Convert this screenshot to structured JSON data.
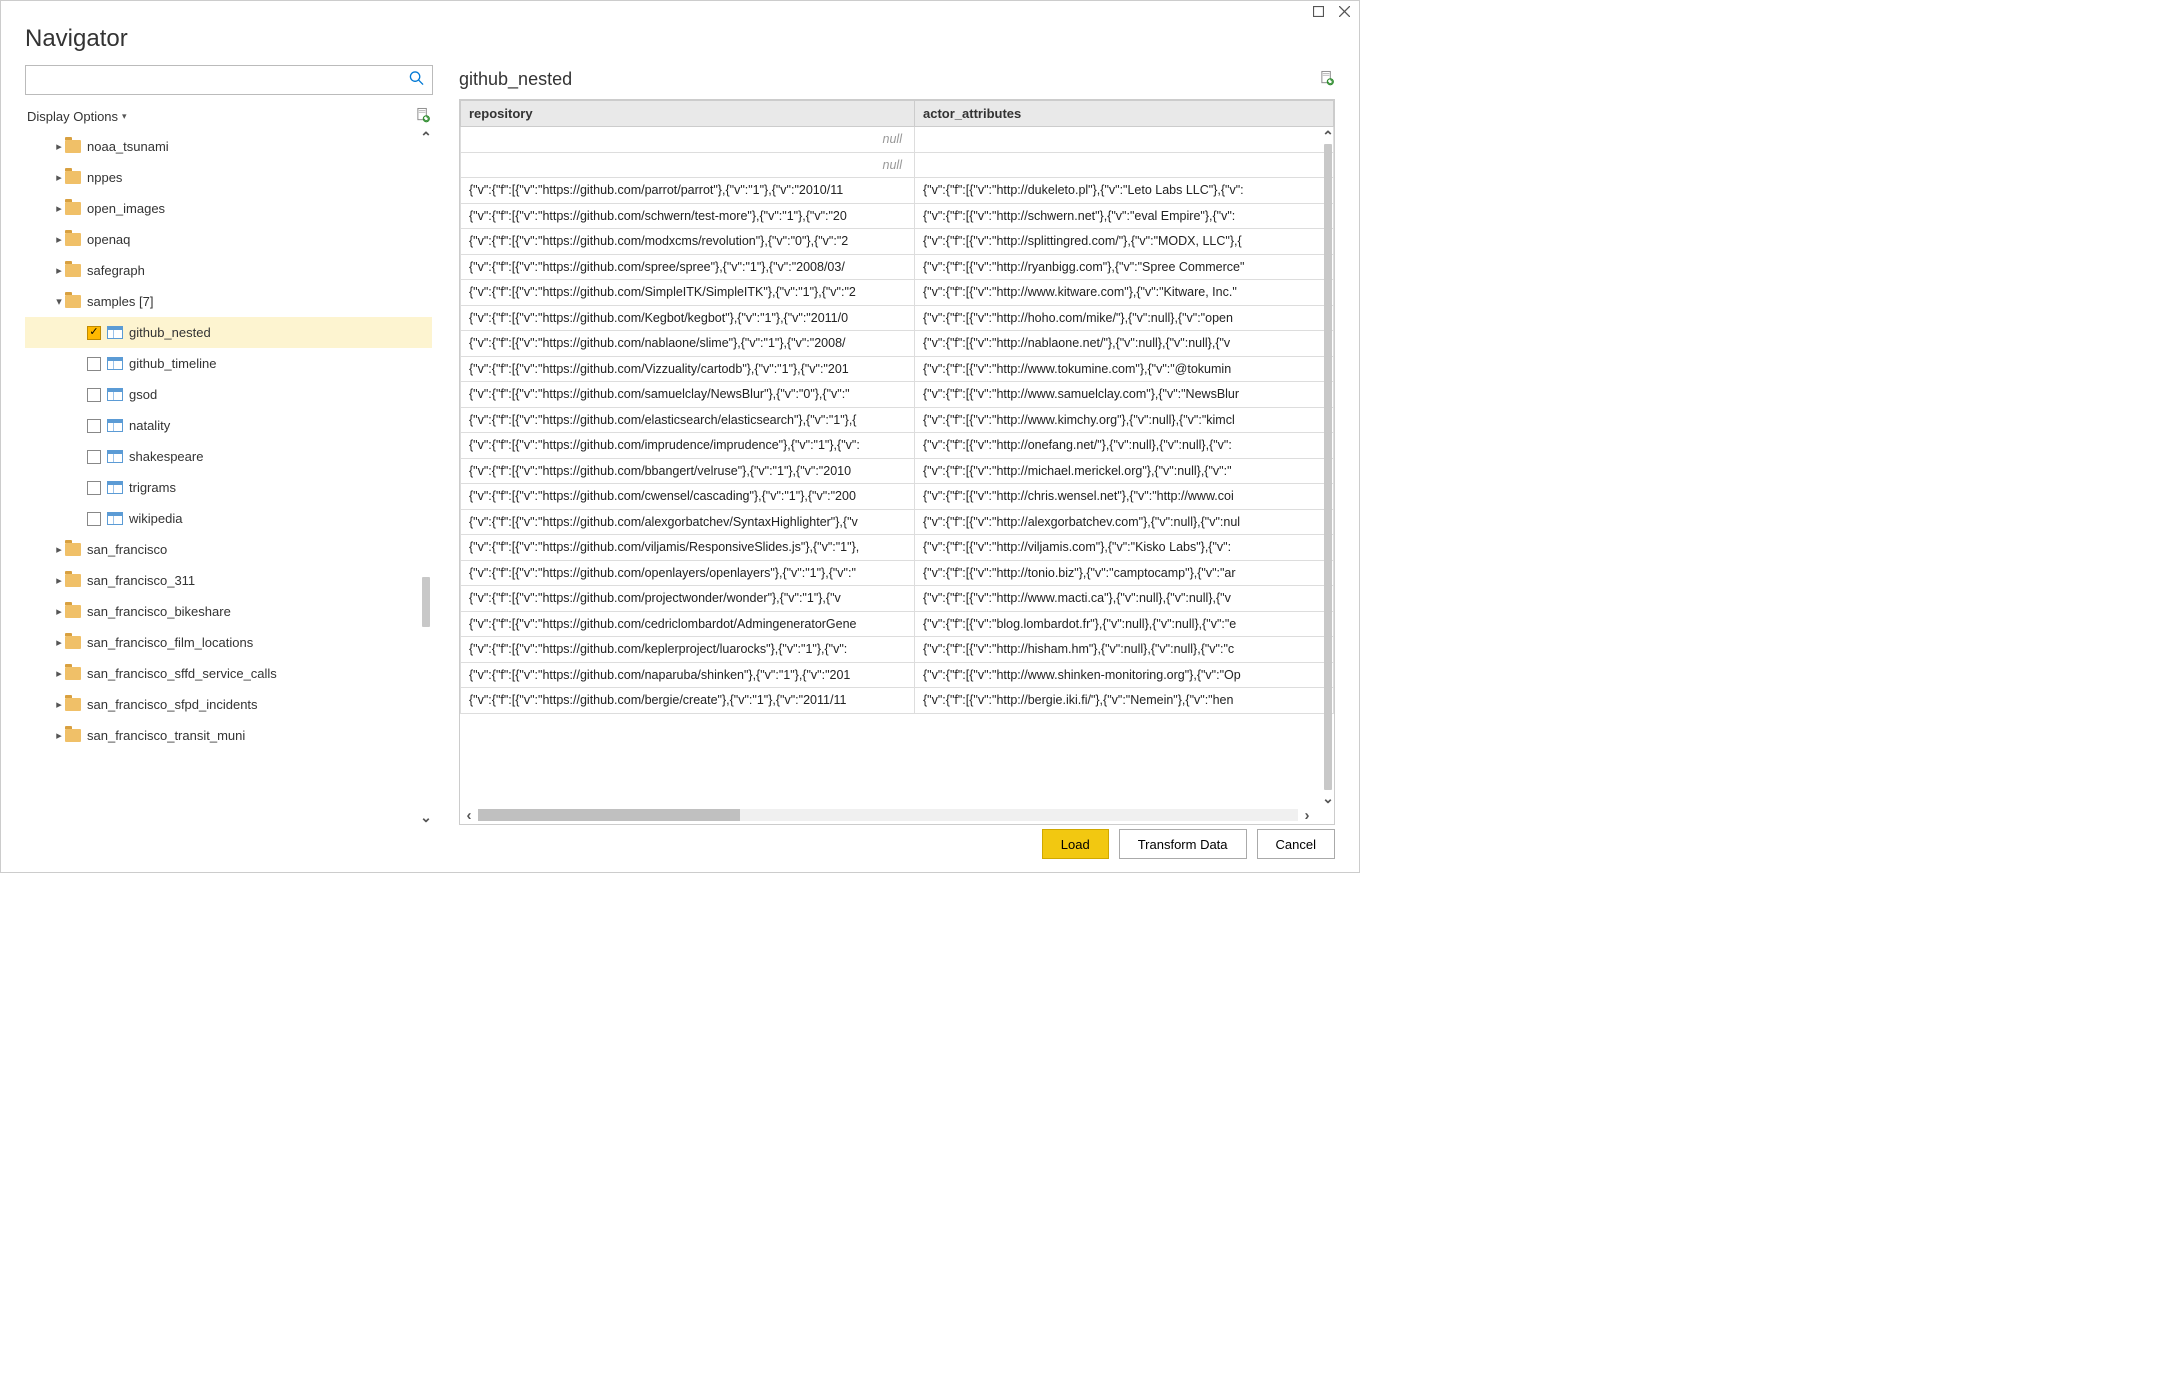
{
  "window": {
    "title": "Navigator"
  },
  "search": {
    "placeholder": ""
  },
  "options": {
    "label": "Display Options"
  },
  "tree": {
    "items": [
      {
        "indent": 1,
        "arrow": "closed",
        "icon": "folder",
        "label": "noaa_tsunami",
        "interactable_row": true
      },
      {
        "indent": 1,
        "arrow": "closed",
        "icon": "folder",
        "label": "nppes"
      },
      {
        "indent": 1,
        "arrow": "closed",
        "icon": "folder",
        "label": "open_images"
      },
      {
        "indent": 1,
        "arrow": "closed",
        "icon": "folder",
        "label": "openaq"
      },
      {
        "indent": 1,
        "arrow": "closed",
        "icon": "folder",
        "label": "safegraph"
      },
      {
        "indent": 1,
        "arrow": "open",
        "icon": "folder",
        "label": "samples [7]"
      },
      {
        "indent": 2,
        "arrow": "none",
        "icon": "table",
        "label": "github_nested",
        "checked": true,
        "selected": true,
        "checkbox": true
      },
      {
        "indent": 2,
        "arrow": "none",
        "icon": "table",
        "label": "github_timeline",
        "checkbox": true
      },
      {
        "indent": 2,
        "arrow": "none",
        "icon": "table",
        "label": "gsod",
        "checkbox": true
      },
      {
        "indent": 2,
        "arrow": "none",
        "icon": "table",
        "label": "natality",
        "checkbox": true
      },
      {
        "indent": 2,
        "arrow": "none",
        "icon": "table",
        "label": "shakespeare",
        "checkbox": true
      },
      {
        "indent": 2,
        "arrow": "none",
        "icon": "table",
        "label": "trigrams",
        "checkbox": true
      },
      {
        "indent": 2,
        "arrow": "none",
        "icon": "table",
        "label": "wikipedia",
        "checkbox": true
      },
      {
        "indent": 1,
        "arrow": "closed",
        "icon": "folder",
        "label": "san_francisco"
      },
      {
        "indent": 1,
        "arrow": "closed",
        "icon": "folder",
        "label": "san_francisco_311"
      },
      {
        "indent": 1,
        "arrow": "closed",
        "icon": "folder",
        "label": "san_francisco_bikeshare"
      },
      {
        "indent": 1,
        "arrow": "closed",
        "icon": "folder",
        "label": "san_francisco_film_locations"
      },
      {
        "indent": 1,
        "arrow": "closed",
        "icon": "folder",
        "label": "san_francisco_sffd_service_calls"
      },
      {
        "indent": 1,
        "arrow": "closed",
        "icon": "folder",
        "label": "san_francisco_sfpd_incidents"
      },
      {
        "indent": 1,
        "arrow": "closed",
        "icon": "folder",
        "label": "san_francisco_transit_muni"
      }
    ]
  },
  "preview": {
    "title": "github_nested",
    "columns": [
      "repository",
      "actor_attributes"
    ],
    "rows": [
      {
        "repository_null": true,
        "actor_null": true
      },
      {
        "repository_null": true,
        "actor_null": true
      },
      {
        "repository": "{\"v\":{\"f\":[{\"v\":\"https://github.com/parrot/parrot\"},{\"v\":\"1\"},{\"v\":\"2010/11",
        "actor": "{\"v\":{\"f\":[{\"v\":\"http://dukeleto.pl\"},{\"v\":\"Leto Labs LLC\"},{\"v\":"
      },
      {
        "repository": "{\"v\":{\"f\":[{\"v\":\"https://github.com/schwern/test-more\"},{\"v\":\"1\"},{\"v\":\"20",
        "actor": "{\"v\":{\"f\":[{\"v\":\"http://schwern.net\"},{\"v\":\"eval Empire\"},{\"v\":"
      },
      {
        "repository": "{\"v\":{\"f\":[{\"v\":\"https://github.com/modxcms/revolution\"},{\"v\":\"0\"},{\"v\":\"2",
        "actor": "{\"v\":{\"f\":[{\"v\":\"http://splittingred.com/\"},{\"v\":\"MODX, LLC\"},{"
      },
      {
        "repository": "{\"v\":{\"f\":[{\"v\":\"https://github.com/spree/spree\"},{\"v\":\"1\"},{\"v\":\"2008/03/",
        "actor": "{\"v\":{\"f\":[{\"v\":\"http://ryanbigg.com\"},{\"v\":\"Spree Commerce\""
      },
      {
        "repository": "{\"v\":{\"f\":[{\"v\":\"https://github.com/SimpleITK/SimpleITK\"},{\"v\":\"1\"},{\"v\":\"2",
        "actor": "{\"v\":{\"f\":[{\"v\":\"http://www.kitware.com\"},{\"v\":\"Kitware, Inc.\""
      },
      {
        "repository": "{\"v\":{\"f\":[{\"v\":\"https://github.com/Kegbot/kegbot\"},{\"v\":\"1\"},{\"v\":\"2011/0",
        "actor": "{\"v\":{\"f\":[{\"v\":\"http://hoho.com/mike/\"},{\"v\":null},{\"v\":\"open"
      },
      {
        "repository": "{\"v\":{\"f\":[{\"v\":\"https://github.com/nablaone/slime\"},{\"v\":\"1\"},{\"v\":\"2008/",
        "actor": "{\"v\":{\"f\":[{\"v\":\"http://nablaone.net/\"},{\"v\":null},{\"v\":null},{\"v"
      },
      {
        "repository": "{\"v\":{\"f\":[{\"v\":\"https://github.com/Vizzuality/cartodb\"},{\"v\":\"1\"},{\"v\":\"201",
        "actor": "{\"v\":{\"f\":[{\"v\":\"http://www.tokumine.com\"},{\"v\":\"@tokumin"
      },
      {
        "repository": "{\"v\":{\"f\":[{\"v\":\"https://github.com/samuelclay/NewsBlur\"},{\"v\":\"0\"},{\"v\":\"",
        "actor": "{\"v\":{\"f\":[{\"v\":\"http://www.samuelclay.com\"},{\"v\":\"NewsBlur"
      },
      {
        "repository": "{\"v\":{\"f\":[{\"v\":\"https://github.com/elasticsearch/elasticsearch\"},{\"v\":\"1\"},{",
        "actor": "{\"v\":{\"f\":[{\"v\":\"http://www.kimchy.org\"},{\"v\":null},{\"v\":\"kimcl"
      },
      {
        "repository": "{\"v\":{\"f\":[{\"v\":\"https://github.com/imprudence/imprudence\"},{\"v\":\"1\"},{\"v\":",
        "actor": "{\"v\":{\"f\":[{\"v\":\"http://onefang.net/\"},{\"v\":null},{\"v\":null},{\"v\":"
      },
      {
        "repository": "{\"v\":{\"f\":[{\"v\":\"https://github.com/bbangert/velruse\"},{\"v\":\"1\"},{\"v\":\"2010",
        "actor": "{\"v\":{\"f\":[{\"v\":\"http://michael.merickel.org\"},{\"v\":null},{\"v\":\""
      },
      {
        "repository": "{\"v\":{\"f\":[{\"v\":\"https://github.com/cwensel/cascading\"},{\"v\":\"1\"},{\"v\":\"200",
        "actor": "{\"v\":{\"f\":[{\"v\":\"http://chris.wensel.net\"},{\"v\":\"http://www.coi"
      },
      {
        "repository": "{\"v\":{\"f\":[{\"v\":\"https://github.com/alexgorbatchev/SyntaxHighlighter\"},{\"v",
        "actor": "{\"v\":{\"f\":[{\"v\":\"http://alexgorbatchev.com\"},{\"v\":null},{\"v\":nul"
      },
      {
        "repository": "{\"v\":{\"f\":[{\"v\":\"https://github.com/viljamis/ResponsiveSlides.js\"},{\"v\":\"1\"},",
        "actor": "{\"v\":{\"f\":[{\"v\":\"http://viljamis.com\"},{\"v\":\"Kisko Labs\"},{\"v\":"
      },
      {
        "repository": "{\"v\":{\"f\":[{\"v\":\"https://github.com/openlayers/openlayers\"},{\"v\":\"1\"},{\"v\":\"",
        "actor": "{\"v\":{\"f\":[{\"v\":\"http://tonio.biz\"},{\"v\":\"camptocamp\"},{\"v\":\"ar"
      },
      {
        "repository": "{\"v\":{\"f\":[{\"v\":\"https://github.com/projectwonder/wonder\"},{\"v\":\"1\"},{\"v",
        "actor": "{\"v\":{\"f\":[{\"v\":\"http://www.macti.ca\"},{\"v\":null},{\"v\":null},{\"v"
      },
      {
        "repository": "{\"v\":{\"f\":[{\"v\":\"https://github.com/cedriclombardot/AdmingeneratorGene",
        "actor": "{\"v\":{\"f\":[{\"v\":\"blog.lombardot.fr\"},{\"v\":null},{\"v\":null},{\"v\":\"e"
      },
      {
        "repository": "{\"v\":{\"f\":[{\"v\":\"https://github.com/keplerproject/luarocks\"},{\"v\":\"1\"},{\"v\":",
        "actor": "{\"v\":{\"f\":[{\"v\":\"http://hisham.hm\"},{\"v\":null},{\"v\":null},{\"v\":\"c"
      },
      {
        "repository": "{\"v\":{\"f\":[{\"v\":\"https://github.com/naparuba/shinken\"},{\"v\":\"1\"},{\"v\":\"201",
        "actor": "{\"v\":{\"f\":[{\"v\":\"http://www.shinken-monitoring.org\"},{\"v\":\"Op"
      },
      {
        "repository": "{\"v\":{\"f\":[{\"v\":\"https://github.com/bergie/create\"},{\"v\":\"1\"},{\"v\":\"2011/11",
        "actor": "{\"v\":{\"f\":[{\"v\":\"http://bergie.iki.fi/\"},{\"v\":\"Nemein\"},{\"v\":\"hen"
      }
    ]
  },
  "buttons": {
    "load": "Load",
    "transform": "Transform Data",
    "cancel": "Cancel"
  }
}
